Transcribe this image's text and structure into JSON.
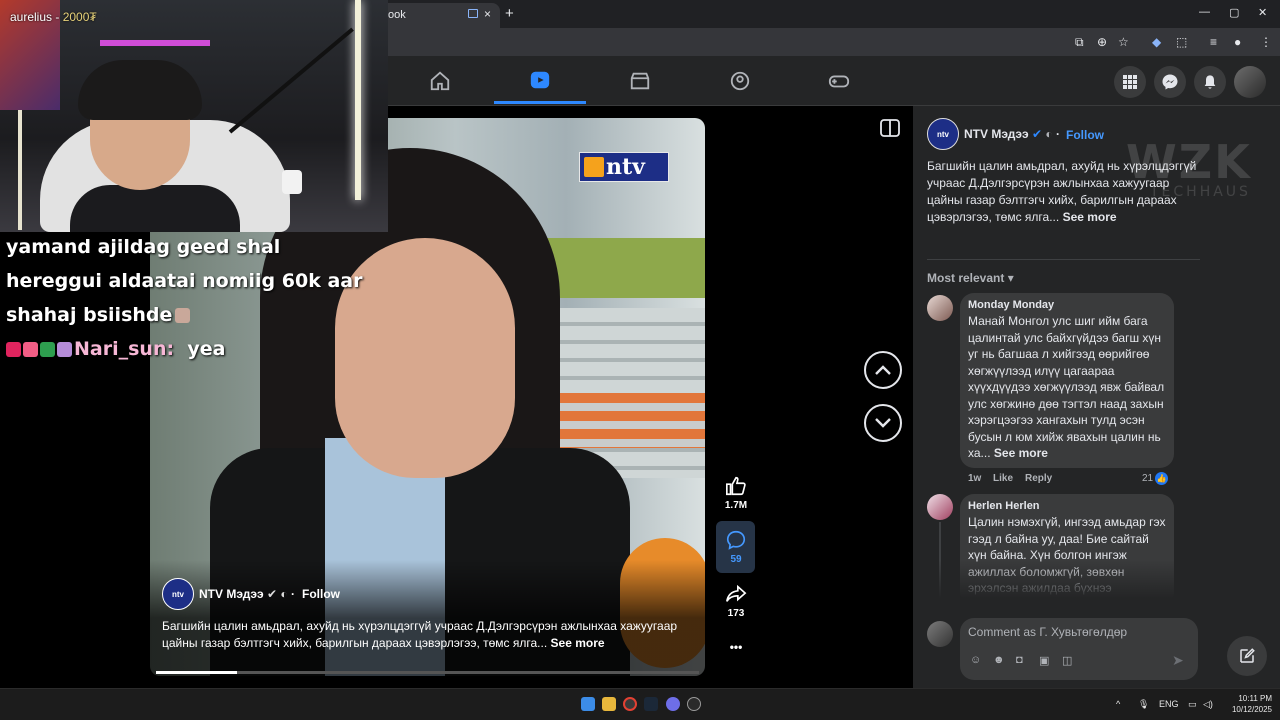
{
  "browser": {
    "tab_title": "ook",
    "tab_close": "×",
    "new_tab": "+",
    "min": "—",
    "max": "▢",
    "close": "✕"
  },
  "fb_nav": {
    "items": [
      "home-icon",
      "video-icon",
      "marketplace-icon",
      "groups-icon",
      "gaming-icon"
    ],
    "active": "video-icon",
    "accent": "#2d88ff"
  },
  "video": {
    "channel_name": "NTV Мэдээ",
    "channel_logo_text": "ntv",
    "follow_label": "Follow",
    "caption": "Багшийн цалин амьдрал, ахуйд нь хүрэлцдэггүй учраас  Д.Дэлгэрсүрэн ажлынхаа хажуугаар цайны газар бэлтгэгч хийх, барилгын дараах цэвэрлэгээ, төмс ялга...",
    "see_more": "See more",
    "progress": 0.15,
    "likes": "1.7M",
    "comments": "59",
    "shares": "173",
    "more": "•••"
  },
  "panel": {
    "channel_name": "NTV Мэдээ",
    "dot": "·",
    "follow_label": "Follow",
    "caption": "Багшийн цалин амьдрал, ахуйд нь хүрэлцдэггүй учраас  Д.Дэлгэрсүрэн ажлынхаа хажуугаар цайны газар бэлтгэгч хийх, барилгын дараах цэвэрлэгээ, төмс ялга...",
    "see_more": "See more",
    "sort_label": "Most relevant",
    "comments": [
      {
        "author": "Monday Monday",
        "text": "Манай Монгол улс шиг ийм бага цалинтай улс байхгүйдээ багш хүн уг нь багшаа л хийгээд өөрийгөө хөгжүүлээд илүү цагаараа хүүхдүүдээ хөгжүүлээд явж байвал улс хөгжинө дөө тэгтэл наад захын хэрэгцээгээ хангахын тулд эсэн бусын л юм хийж явахын цалин нь ха...",
        "see_more": "See more",
        "time": "1w",
        "like": "Like",
        "reply": "Reply",
        "reactions": "21"
      },
      {
        "author": "Herlen Herlen",
        "text": "Цалин нэмэхгүй, ингээд амьдар гэх гээд л байна уу, даа! Бие сайтай хүн байна. Хүн болгон ингэж ажиллах боломжгүй, зөвхөн эрхэлсэн ажилдаа бүхнээ зориулдаг байж л болно шүү дээ!"
      }
    ],
    "comment_placeholder": "Comment as Г. Хувьтөгөлдөр",
    "send": "➤"
  },
  "watermark": {
    "big": "WZK",
    "small": "TECHHAUS"
  },
  "stream": {
    "streamer": "aurelius - ",
    "amount": "2000₮",
    "chat": [
      "yamand ajildag geed shal",
      "hereggui aldaatai nomiig 60k aar",
      "shahaj bsiishde"
    ],
    "chat_user": "Nari_sun:",
    "chat_user_msg": "yea"
  },
  "taskbar": {
    "lang": "ENG",
    "time": "10:11 PM",
    "date": "10/12/2025",
    "chevron": "^"
  }
}
